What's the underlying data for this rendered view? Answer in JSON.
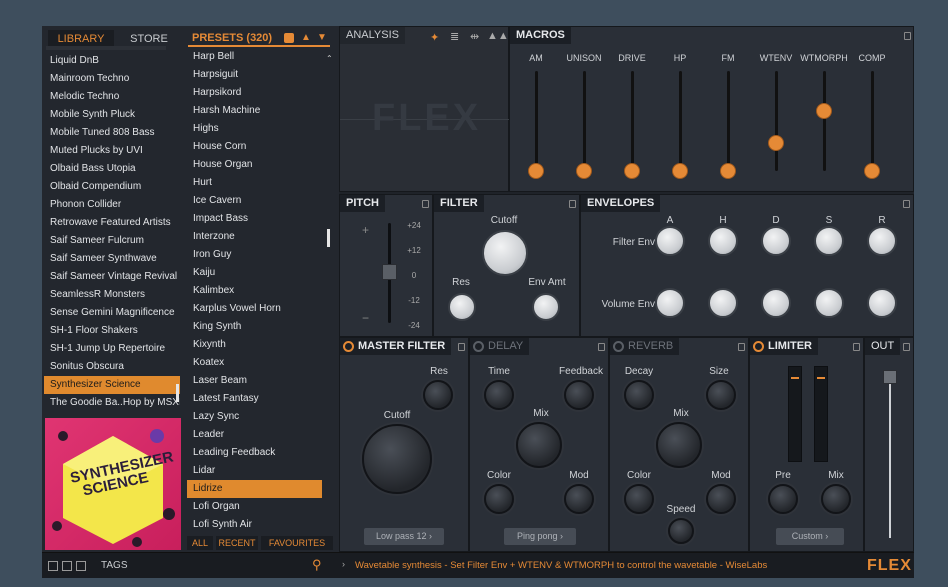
{
  "tabs": {
    "library": "LIBRARY",
    "store": "STORE"
  },
  "presets_header": "PRESETS (320)",
  "library_items": [
    "Liquid DnB",
    "Mainroom Techno",
    "Melodic Techno",
    "Mobile Synth Pluck",
    "Mobile Tuned 808 Bass",
    "Muted Plucks by UVI",
    "Olbaid Bass Utopia",
    "Olbaid Compendium",
    "Phonon Collider",
    "Retrowave Featured Artists",
    "Saif Sameer Fulcrum",
    "Saif Sameer Synthwave",
    "Saif Sameer Vintage Revival",
    "SeamlessR Monsters",
    "Sense Gemini Magnificence",
    "SH-1 Floor Shakers",
    "SH-1 Jump Up Repertoire",
    "Sonitus Obscura",
    "Synthesizer Science",
    "The Goodie Ba..Hop by MSXII"
  ],
  "preset_items": [
    "Harp Bell",
    "Harpsiguit",
    "Harpsikord",
    "Harsh Machine",
    "Highs",
    "House Corn",
    "House Organ",
    "Hurt",
    "Ice Cavern",
    "Impact Bass",
    "Interzone",
    "Iron Guy",
    "Kaiju",
    "Kalimbex",
    "Karplus Vowel Horn",
    "King Synth",
    "Kixynth",
    "Koatex",
    "Laser Beam",
    "Latest Fantasy",
    "Lazy Sync",
    "Leader",
    "Leading Feedback",
    "Lidar",
    "Lidrize",
    "Lofi Organ",
    "Lofi Synth Air"
  ],
  "artwork_text": "SYNTHESIZER SCIENCE",
  "filter_tabs": {
    "all": "ALL",
    "recent": "RECENT",
    "favourites": "FAVOURITES"
  },
  "tags_label": "TAGS",
  "analysis": {
    "title": "ANALYSIS",
    "watermark": "FLEX"
  },
  "macros": {
    "title": "MACROS",
    "labels": [
      "AM",
      "UNISON",
      "DRIVE",
      "HP",
      "FM",
      "WTENV",
      "WTMORPH",
      "COMP"
    ],
    "levels": [
      0,
      0,
      0,
      0,
      0,
      0.28,
      0.6,
      0
    ]
  },
  "pitch": {
    "title": "PITCH",
    "marks": [
      "+24",
      "+12",
      "0",
      "-12",
      "-24"
    ]
  },
  "filter": {
    "title": "FILTER",
    "cutoff": "Cutoff",
    "res": "Res",
    "env_amt": "Env Amt"
  },
  "envelopes": {
    "title": "ENVELOPES",
    "cols": [
      "A",
      "H",
      "D",
      "S",
      "R"
    ],
    "rows": [
      "Filter Env",
      "Volume Env"
    ]
  },
  "master_filter": {
    "title": "MASTER FILTER",
    "res": "Res",
    "cutoff": "Cutoff",
    "mode": "Low pass 12"
  },
  "delay": {
    "title": "DELAY",
    "time": "Time",
    "feedback": "Feedback",
    "mix": "Mix",
    "color": "Color",
    "mod": "Mod",
    "mode": "Ping pong"
  },
  "reverb": {
    "title": "REVERB",
    "decay": "Decay",
    "size": "Size",
    "mix": "Mix",
    "color": "Color",
    "mod": "Mod",
    "speed": "Speed"
  },
  "limiter": {
    "title": "LIMITER",
    "pre": "Pre",
    "mix": "Mix",
    "mode": "Custom"
  },
  "out": {
    "title": "OUT"
  },
  "status": "Wavetable synthesis - Set Filter Env + WTENV & WTMORPH to control the wavetable - WiseLabs",
  "logo": "FLEX",
  "colors": {
    "accent": "#e58a36",
    "selection": "#e08a2e",
    "background": "#1f2329"
  }
}
